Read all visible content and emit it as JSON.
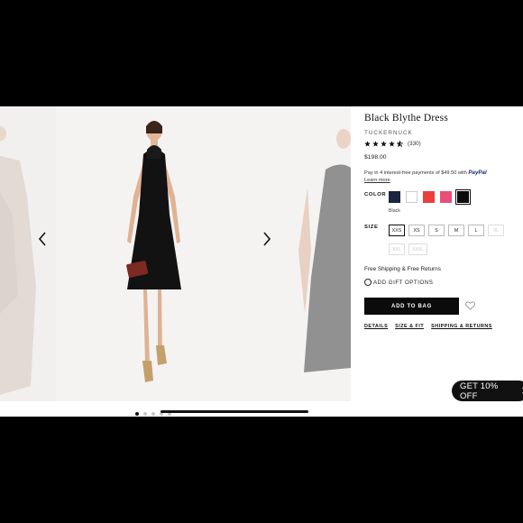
{
  "product": {
    "title": "Black Blythe Dress",
    "brand": "TUCKERNUCK",
    "rating_count": "(330)",
    "price": "$198.00",
    "paypal_text": "Pay in 4 interest-free payments of $49.50 with",
    "paypal_brand": "PayPal",
    "learn_more": "Learn more"
  },
  "color": {
    "label": "COLOR",
    "selected_name": "Black",
    "swatches": [
      "#1b2440",
      "#ffffff",
      "#e8403b",
      "#e94f78",
      "#0b0b0b"
    ]
  },
  "size": {
    "label": "SIZE",
    "row1": [
      "XXS",
      "XS",
      "S",
      "M",
      "L",
      "XL"
    ],
    "row2": [
      "XXL",
      "XXXL"
    ]
  },
  "shipping_text": "Free Shipping & Free Returns",
  "gift_text": "ADD GIFT OPTIONS",
  "add_to_bag": "ADD TO BAG",
  "links": {
    "details": "DETAILS",
    "size_fit": "SIZE & FIT",
    "shipping_returns": "SHIPPING & RETURNS"
  },
  "promo": {
    "text": "GET 10% OFF",
    "close": "✕"
  },
  "icons": [
    "chevron-left-icon",
    "chevron-right-icon",
    "star-icon",
    "heart-icon",
    "close-icon"
  ]
}
